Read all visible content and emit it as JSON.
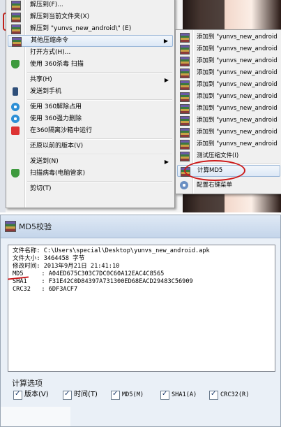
{
  "context_menu": {
    "main_items": [
      {
        "label": "解压到(F)...",
        "icon": "archive-icon"
      },
      {
        "label": "解压到当前文件夹(X)",
        "icon": "archive-icon"
      },
      {
        "label": "解压到 \"yunvs_new_android\\\" (E)",
        "icon": "archive-icon"
      },
      {
        "label": "其他压缩命令",
        "icon": "archive-icon",
        "submenu": true
      },
      {
        "label": "打开方式(H)...",
        "icon": ""
      },
      {
        "label": "使用 360杀毒 扫描",
        "icon": "shield-icon"
      },
      {
        "label": "共享(H)",
        "icon": "",
        "submenu": true
      },
      {
        "label": "发送到手机",
        "icon": "phone-icon"
      },
      {
        "label": "使用 360解除占用",
        "icon": "360-icon"
      },
      {
        "label": "使用 360强力删除",
        "icon": "360-icon"
      },
      {
        "label": "在360隔离沙箱中运行",
        "icon": "sandbox-icon"
      },
      {
        "label": "还原以前的版本(V)",
        "icon": ""
      },
      {
        "label": "发送到(N)",
        "icon": "",
        "submenu": true
      },
      {
        "label": "扫描病毒(电脑管家)",
        "icon": "shield-icon"
      },
      {
        "label": "剪切(T)",
        "icon": ""
      }
    ],
    "sub_items": [
      {
        "label": "添加到 \"yunvs_new_android",
        "icon": "archive-icon"
      },
      {
        "label": "添加到 \"yunvs_new_android",
        "icon": "archive-icon"
      },
      {
        "label": "添加到 \"yunvs_new_android",
        "icon": "archive-icon"
      },
      {
        "label": "添加到 \"yunvs_new_android",
        "icon": "archive-icon"
      },
      {
        "label": "添加到 \"yunvs_new_android",
        "icon": "archive-icon"
      },
      {
        "label": "添加到 \"yunvs_new_android",
        "icon": "archive-icon"
      },
      {
        "label": "添加到 \"yunvs_new_android",
        "icon": "archive-icon"
      },
      {
        "label": "添加到 \"yunvs_new_android",
        "icon": "archive-icon"
      },
      {
        "label": "添加到 \"yunvs_new_android",
        "icon": "archive-icon"
      },
      {
        "label": "添加到 \"yunvs_new_android",
        "icon": "archive-icon"
      },
      {
        "label": "测试压缩文件(I)",
        "icon": "archive-icon"
      },
      {
        "label": "计算MD5",
        "icon": "archive-icon",
        "highlighted": true
      },
      {
        "label": "配置右键菜单",
        "icon": "gear-icon"
      }
    ]
  },
  "dialog": {
    "title": "MD5校验",
    "lines": [
      "文件名称: C:\\Users\\special\\Desktop\\yunvs_new_android.apk",
      "文件大小: 3464458 字节",
      "修改时间: 2013年9月21日 21:41:10",
      "MD5     : A04ED675C303C7DC0C60A12EAC4C8565",
      "SHA1    : F31E42C0D84397A731300ED68EACD29483C56909",
      "CRC32   : 6DF3ACF7"
    ],
    "options_label": "计算选项",
    "options": [
      {
        "label": "版本(V)",
        "checked": true
      },
      {
        "label": "时间(T)",
        "checked": true
      },
      {
        "label": "MD5(M)",
        "checked": true
      },
      {
        "label": "SHA1(A)",
        "checked": true
      },
      {
        "label": "CRC32(R)",
        "checked": true
      }
    ]
  },
  "colors": {
    "highlight_red": "#cc1a1a",
    "menu_bg": "#f0f0f0",
    "dialog_bg": "#eaf0f7"
  }
}
